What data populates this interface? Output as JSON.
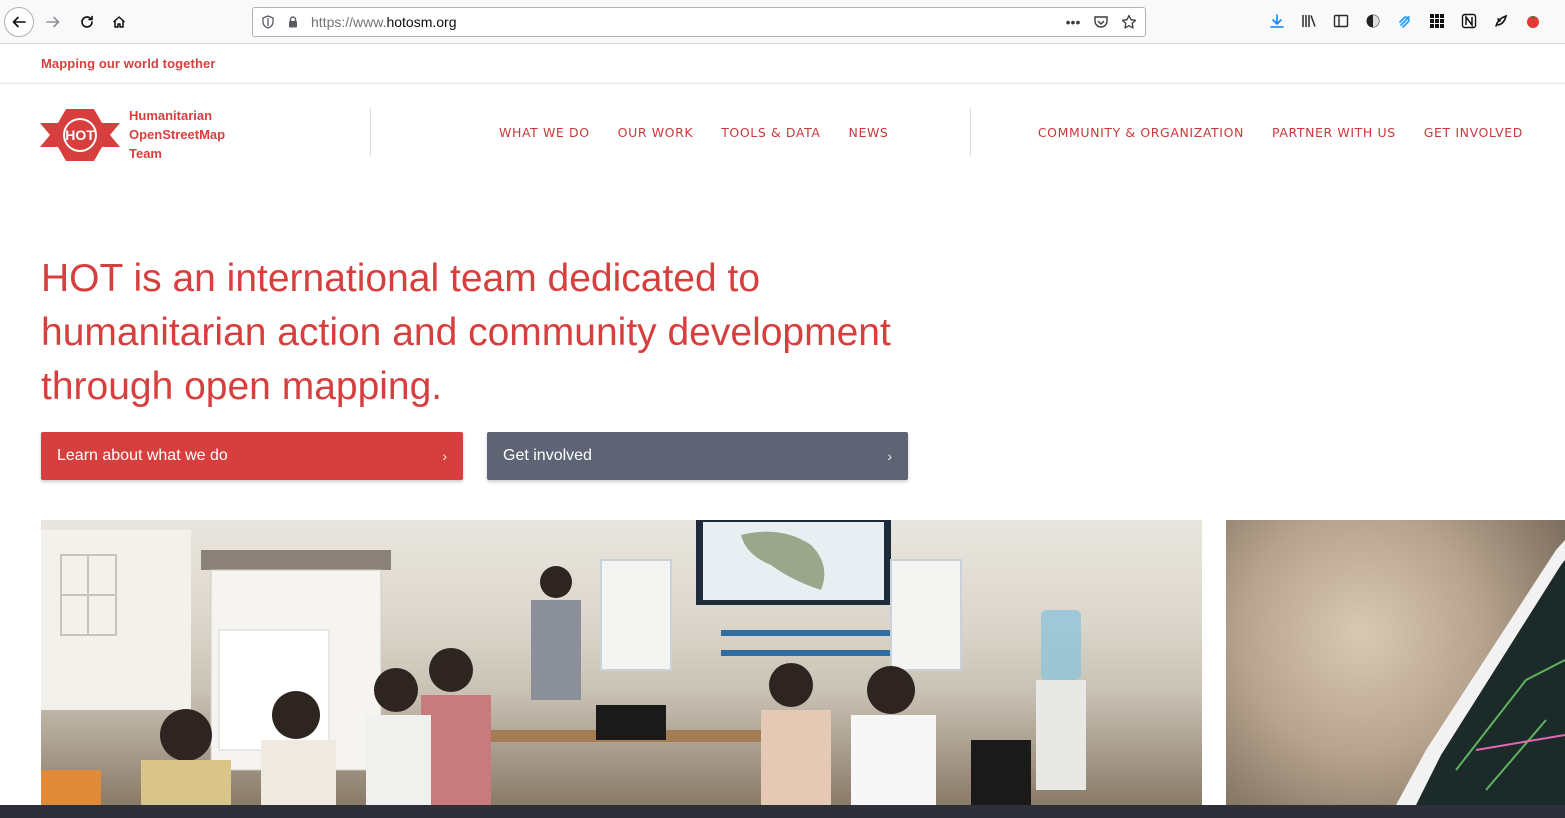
{
  "browser": {
    "url_prefix": "https://www.",
    "url_domain": "hotosm.org",
    "icons": {
      "back": "back-arrow-icon",
      "forward": "forward-arrow-icon",
      "reload": "reload-icon",
      "home": "home-icon",
      "shield": "tracking-shield-icon",
      "lock": "lock-icon",
      "page_actions": "ellipsis-icon",
      "pocket": "pocket-icon",
      "bookmark": "star-icon",
      "download": "download-icon",
      "library": "library-icon",
      "sidebar": "sidebar-icon",
      "extensions": [
        "extension-icon-1",
        "extension-icon-2",
        "grid-icon",
        "notion-icon",
        "extension-icon-3",
        "tomato-icon"
      ]
    }
  },
  "site": {
    "tagline": "Mapping our world together",
    "logo": {
      "mark_text": "HOT",
      "line1": "Humanitarian",
      "line2": "OpenStreetMap",
      "line3": "Team"
    },
    "main_nav": [
      "WHAT WE DO",
      "OUR WORK",
      "TOOLS & DATA",
      "NEWS"
    ],
    "secondary_nav": [
      "COMMUNITY & ORGANIZATION",
      "PARTNER WITH US",
      "GET INVOLVED"
    ]
  },
  "hero": {
    "heading": "HOT is an international team dedicated to humanitarian action and community development through open mapping.",
    "primary_cta": "Learn about what we do",
    "secondary_cta": "Get involved",
    "chevron": "›"
  },
  "colors": {
    "brand_red": "#d73f3f",
    "cta_gray": "#5f6474",
    "footer_dark": "#2d3038"
  }
}
